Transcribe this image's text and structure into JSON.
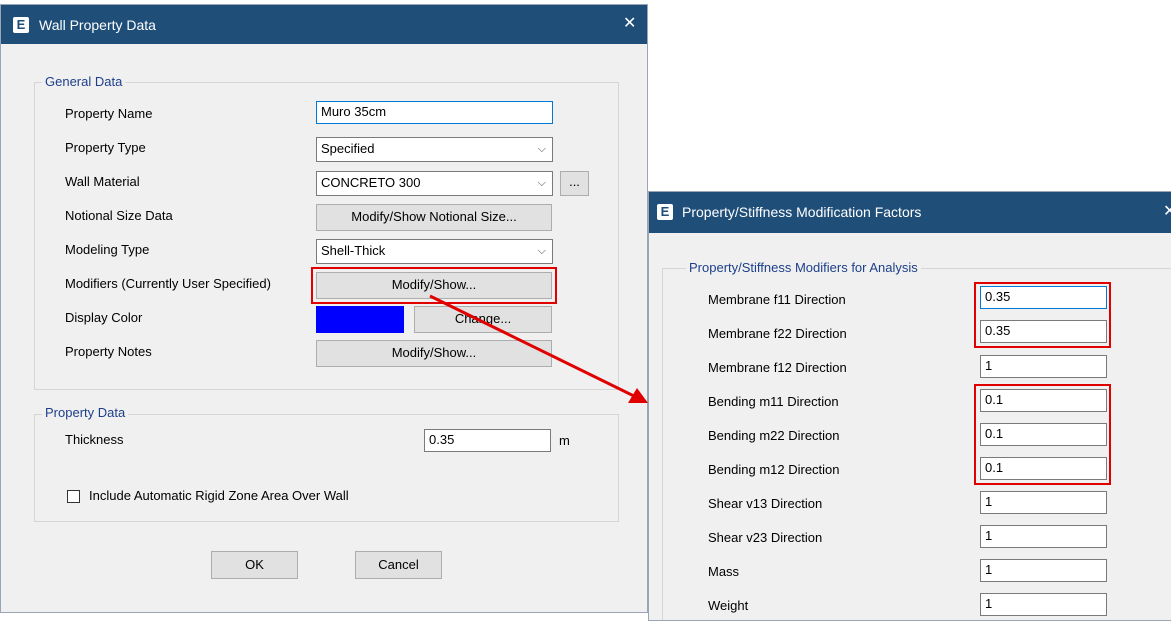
{
  "wall_dialog": {
    "title": "Wall Property Data",
    "general_group": "General Data",
    "property_name_label": "Property Name",
    "property_name_value": "Muro 35cm",
    "property_type_label": "Property Type",
    "property_type_value": "Specified",
    "wall_material_label": "Wall Material",
    "wall_material_value": "CONCRETO 300",
    "ellipsis_label": "...",
    "notional_label": "Notional Size Data",
    "notional_button": "Modify/Show Notional Size...",
    "modeling_type_label": "Modeling Type",
    "modeling_type_value": "Shell-Thick",
    "modifiers_label": "Modifiers (Currently User Specified)",
    "modifiers_button": "Modify/Show...",
    "display_color_label": "Display Color",
    "display_color_value": "#0000ff",
    "change_button": "Change...",
    "property_notes_label": "Property Notes",
    "property_notes_button": "Modify/Show...",
    "property_data_group": "Property Data",
    "thickness_label": "Thickness",
    "thickness_value": "0.35",
    "thickness_unit": "m",
    "rigid_zone_label": "Include Automatic Rigid Zone Area Over Wall",
    "ok_button": "OK",
    "cancel_button": "Cancel"
  },
  "modifier_dialog": {
    "title": "Property/Stiffness Modification Factors",
    "group_label": "Property/Stiffness Modifiers for Analysis",
    "rows": [
      {
        "label": "Membrane f11 Direction",
        "value": "0.35"
      },
      {
        "label": "Membrane f22 Direction",
        "value": "0.35"
      },
      {
        "label": "Membrane f12 Direction",
        "value": "1"
      },
      {
        "label": "Bending m11 Direction",
        "value": "0.1"
      },
      {
        "label": "Bending m22 Direction",
        "value": "0.1"
      },
      {
        "label": "Bending m12 Direction",
        "value": "0.1"
      },
      {
        "label": "Shear v13 Direction",
        "value": "1"
      },
      {
        "label": "Shear v23 Direction",
        "value": "1"
      },
      {
        "label": "Mass",
        "value": "1"
      },
      {
        "label": "Weight",
        "value": "1"
      }
    ]
  },
  "app_icon_letter": "E",
  "close_glyph": "✕",
  "chevron_glyph": "⌵",
  "colors": {
    "titlebar": "#1f4e79",
    "highlight": "#e00000",
    "group_text": "#1d3f8a"
  }
}
